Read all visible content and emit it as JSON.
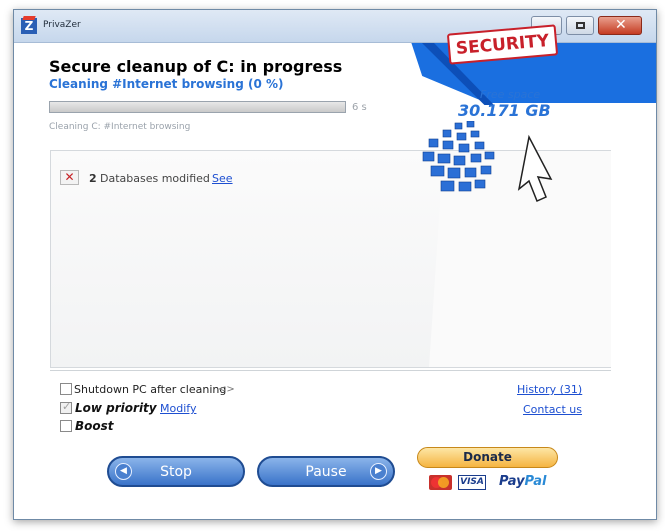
{
  "window": {
    "title": "PrivaZer",
    "logo_letter": "Z",
    "close_glyph": "✕"
  },
  "header": {
    "title": "Secure cleanup of C: in progress",
    "subtitle": "Cleaning #Internet browsing (0 %)",
    "progress_fraction": 0.0,
    "time_remaining": "6 s",
    "status": "Cleaning C: #Internet browsing"
  },
  "results": {
    "modified_icon": "x-mark-icon",
    "count": "2",
    "label": "Databases modified",
    "see_link": "See"
  },
  "security": {
    "stamp": "SECURITY",
    "free_space_label": "Free space",
    "free_space_value": "30.171 GB"
  },
  "options": {
    "shutdown_label": "Shutdown PC after cleaning",
    "shutdown_checked": false,
    "arrows_glyph": "<>",
    "low_priority_label": "Low priority",
    "low_priority_checked": true,
    "modify_link": "Modify",
    "boost_label": "Boost",
    "boost_checked": false
  },
  "links": {
    "history": "History (31)",
    "contact": "Contact us"
  },
  "buttons": {
    "stop_label": "Stop",
    "stop_icon_glyph": "◀",
    "pause_label": "Pause",
    "pause_icon_glyph": "▶"
  },
  "donate": {
    "label": "Donate",
    "visa": "VISA",
    "paypal_a": "Pay",
    "paypal_b": "Pal"
  },
  "colors": {
    "accent_blue": "#2a73d6",
    "banner_blue": "#1a6fe0",
    "security_red": "#c8202a",
    "link_blue": "#1d4fd1"
  }
}
